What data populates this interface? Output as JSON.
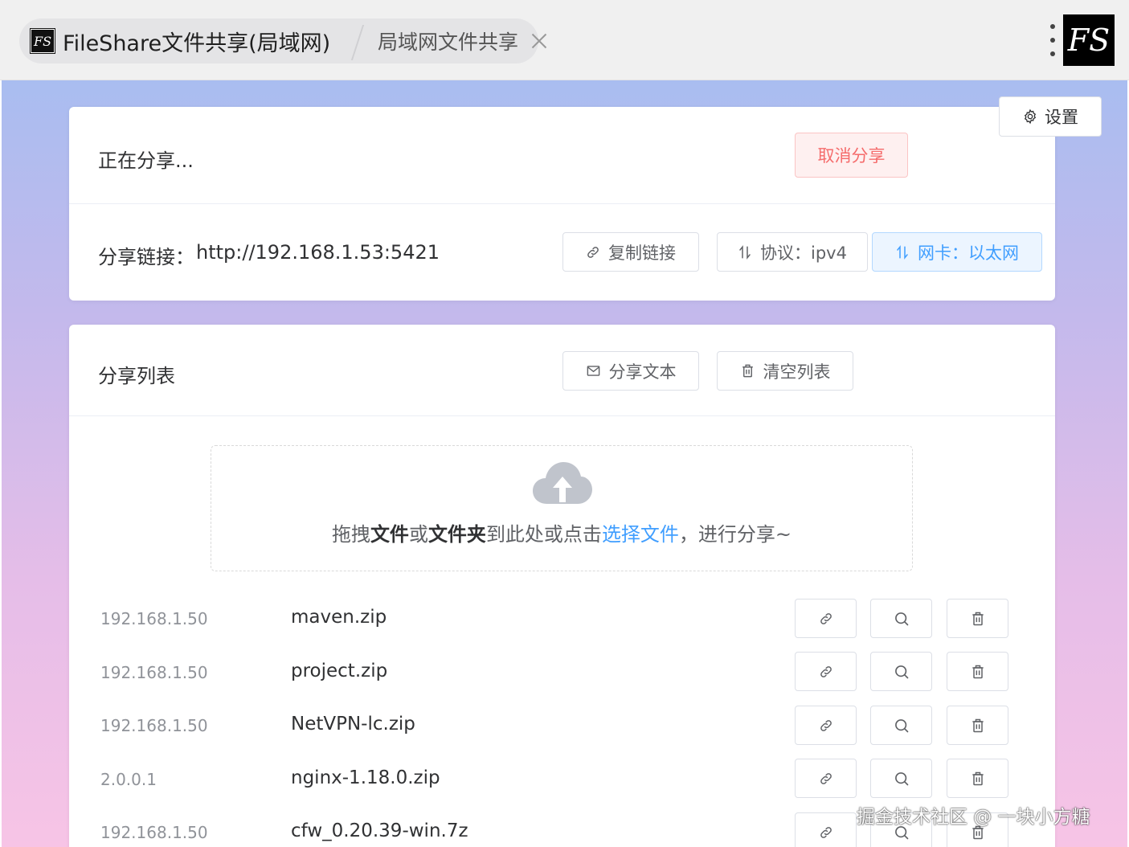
{
  "window": {
    "active_tab": {
      "logo": "FS",
      "title": "FileShare文件共享(局域网)"
    },
    "inactive_tab": {
      "title": "局域网文件共享"
    },
    "app_logo": "FS"
  },
  "settings": {
    "label": "设置",
    "icon": "gear-icon"
  },
  "share_card": {
    "status_text": "正在分享...",
    "cancel_label": "取消分享",
    "link_label": "分享链接：",
    "link_url": "http://192.168.1.53:5421",
    "copy_label": "复制链接",
    "protocol_label": "协议：ipv4",
    "nic_label": "网卡：以太网"
  },
  "list_card": {
    "title": "分享列表",
    "share_text_label": "分享文本",
    "clear_label": "清空列表",
    "dropzone": {
      "prefix": "拖拽",
      "bold1": "文件",
      "mid1": "或",
      "bold2": "文件夹",
      "mid2": "到此处或点击",
      "link": "选择文件",
      "suffix": "，进行分享~"
    },
    "rows": [
      {
        "ip": "192.168.1.50",
        "name": "maven.zip"
      },
      {
        "ip": "192.168.1.50",
        "name": "project.zip"
      },
      {
        "ip": "192.168.1.50",
        "name": "NetVPN-lc.zip"
      },
      {
        "ip": "2.0.0.1",
        "name": "nginx-1.18.0.zip"
      },
      {
        "ip": "192.168.1.50",
        "name": "cfw_0.20.39-win.7z"
      }
    ]
  },
  "watermark": "掘金技术社区 @ 一块小方糖",
  "colors": {
    "primary": "#409eff",
    "danger": "#f56c6c",
    "muted": "#909399"
  }
}
